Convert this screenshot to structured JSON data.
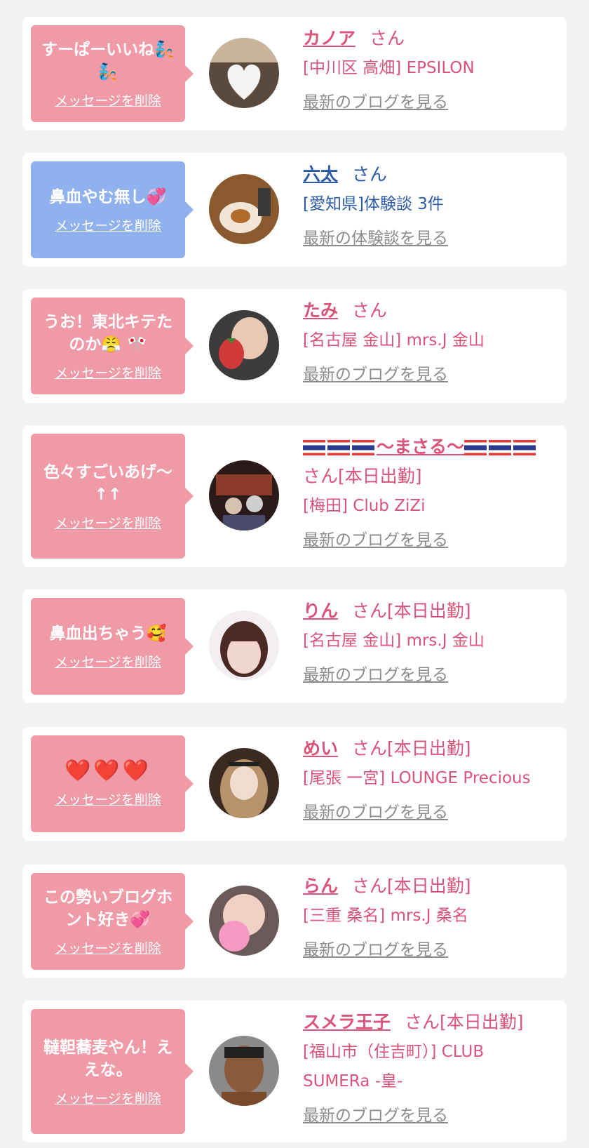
{
  "delete_label": "メッセージを削除",
  "cards": [
    {
      "message": "すーぱーいいね🧞🧞",
      "name": "カノア",
      "suffix": "さん",
      "shop": "[中川区 高畑] EPSILON",
      "link": "最新のブログを見る",
      "theme": "pink"
    },
    {
      "message": "鼻血やむ無し💞",
      "name": "六太",
      "suffix": "さん",
      "shop": "[愛知県]体験談 3件",
      "link": "最新の体験談を見る",
      "theme": "blue"
    },
    {
      "message": "うお！東北キテたのか😤 🎌",
      "name": "たみ",
      "suffix": "さん",
      "shop": "[名古屋 金山] mrs.J 金山",
      "link": "最新のブログを見る",
      "theme": "pink"
    },
    {
      "message": "色々すごいあげ〜↑↑",
      "name": "🇹🇭🇹🇭🇹🇭〜まさる〜🇹🇭🇹🇭🇹🇭",
      "name_text": "〜まさる〜",
      "suffix": "さん[本日出勤]",
      "shop": "[梅田] Club ZiZi",
      "link": "最新のブログを見る",
      "theme": "pink"
    },
    {
      "message": "鼻血出ちゃう🥰",
      "name": "りん",
      "suffix": "さん[本日出勤]",
      "shop": "[名古屋 金山] mrs.J 金山",
      "link": "最新のブログを見る",
      "theme": "pink"
    },
    {
      "message": "❤️❤️❤️",
      "name": "めい",
      "suffix": "さん[本日出勤]",
      "shop": "[尾張 一宮] LOUNGE Precious",
      "link": "最新のブログを見る",
      "theme": "pink"
    },
    {
      "message": "この勢いブログホント好き💞",
      "name": "らん",
      "suffix": "さん[本日出勤]",
      "shop": "[三重 桑名] mrs.J 桑名",
      "link": "最新のブログを見る",
      "theme": "pink"
    },
    {
      "message": "韃靼蕎麦やん！ええな。",
      "name": "スメラ王子",
      "suffix": "さん[本日出勤]",
      "shop": "[福山市（住吉町）] CLUB SUMERa -皇-",
      "link": "最新のブログを見る",
      "theme": "pink"
    }
  ],
  "colors": {
    "pink_bubble": "#f09aa8",
    "blue_bubble": "#8fb2ee",
    "pink_text": "#d9537a",
    "blue_text": "#2d5aa8",
    "link_gray": "#8c8c8c",
    "background": "#f2f2f2"
  }
}
